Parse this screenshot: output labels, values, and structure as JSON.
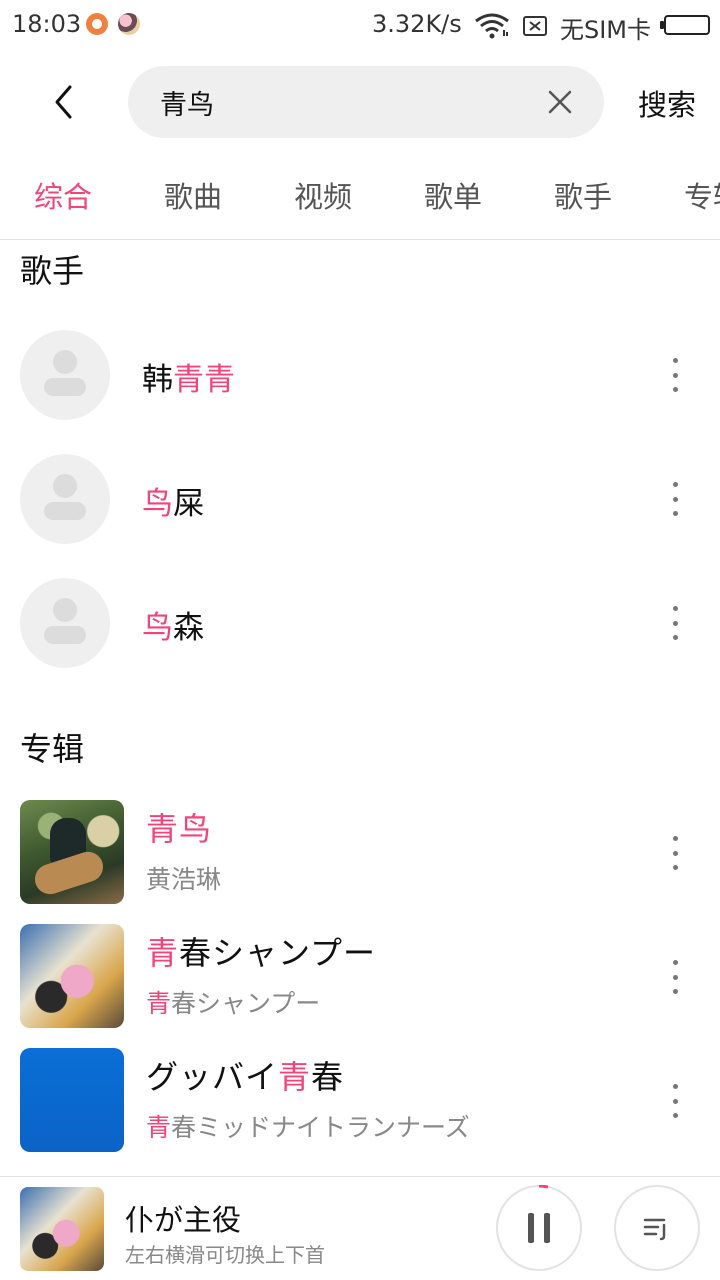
{
  "status_bar": {
    "time": "18:03",
    "speed": "3.32K/s",
    "sim": "无SIM卡",
    "icons": [
      "app-notification-icon",
      "app-avatar-icon",
      "wifi-icon",
      "no-sim-icon",
      "battery-icon"
    ]
  },
  "search": {
    "value": "青鸟",
    "button_label": "搜索"
  },
  "colors": {
    "accent": "#f0457a",
    "text": "#111111",
    "muted": "#888888"
  },
  "tabs": [
    {
      "label": "综合",
      "active": true
    },
    {
      "label": "歌曲",
      "active": false
    },
    {
      "label": "视频",
      "active": false
    },
    {
      "label": "歌单",
      "active": false
    },
    {
      "label": "歌手",
      "active": false
    },
    {
      "label": "专辑",
      "active": false
    }
  ],
  "artists_section": {
    "title": "歌手",
    "items": [
      {
        "name_plain": "韩",
        "name_highlight": "青青"
      },
      {
        "name_highlight": "鸟",
        "name_plain": "屎"
      },
      {
        "name_highlight": "鸟",
        "name_plain": "森"
      }
    ]
  },
  "albums_section": {
    "title": "专辑",
    "items": [
      {
        "title_highlight": "青鸟",
        "title_rest": "",
        "sub_highlight": "",
        "sub_rest": "黄浩琳"
      },
      {
        "title_highlight": "青",
        "title_rest": "春シャンプー",
        "sub_highlight": "青",
        "sub_rest": "春シャンプー"
      },
      {
        "title_pre": "グッバイ",
        "title_highlight": "青",
        "title_rest": "春",
        "sub_highlight": "青",
        "sub_rest": "春ミッドナイトランナーズ"
      }
    ]
  },
  "player": {
    "title": "仆が主役",
    "hint": "左右横滑可切换上下首"
  }
}
